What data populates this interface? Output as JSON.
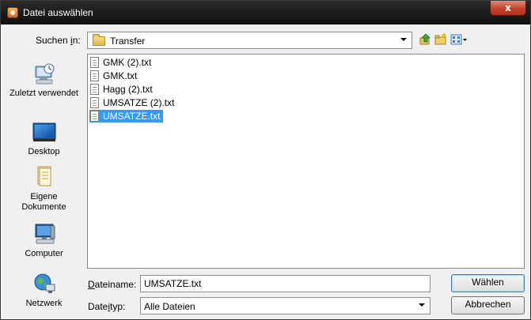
{
  "window": {
    "title": "Datei auswählen",
    "close_glyph": "x"
  },
  "toolbar": {
    "lookin_label_prefix": "Suchen ",
    "lookin_label_hot": "i",
    "lookin_label_suffix": "n:",
    "lookin_value": "Transfer",
    "icons": [
      "up-folder-icon",
      "new-folder-icon",
      "view-menu-icon"
    ]
  },
  "places": [
    {
      "label": "Zuletzt verwendet",
      "icon": "recent-places-icon"
    },
    {
      "label": "Desktop",
      "icon": "desktop-icon"
    },
    {
      "label": "Eigene Dokumente",
      "icon": "documents-icon"
    },
    {
      "label": "Computer",
      "icon": "computer-icon"
    },
    {
      "label": "Netzwerk",
      "icon": "network-icon"
    }
  ],
  "files": [
    {
      "name": "GMK (2).txt",
      "selected": false
    },
    {
      "name": "GMK.txt",
      "selected": false
    },
    {
      "name": "Hagg (2).txt",
      "selected": false
    },
    {
      "name": "UMSATZE (2).txt",
      "selected": false
    },
    {
      "name": "UMSATZE.txt",
      "selected": true
    }
  ],
  "filename": {
    "label_hot": "D",
    "label_rest": "ateiname:",
    "value": "UMSATZE.txt"
  },
  "filetype": {
    "label_prefix": "Date",
    "label_hot": "i",
    "label_suffix": "typ:",
    "value": "Alle Dateien"
  },
  "buttons": {
    "ok": "Wählen",
    "cancel": "Abbrechen"
  },
  "colors": {
    "selection": "#3399ff",
    "titlebar": "#1a1a1a",
    "close": "#c2432a"
  }
}
